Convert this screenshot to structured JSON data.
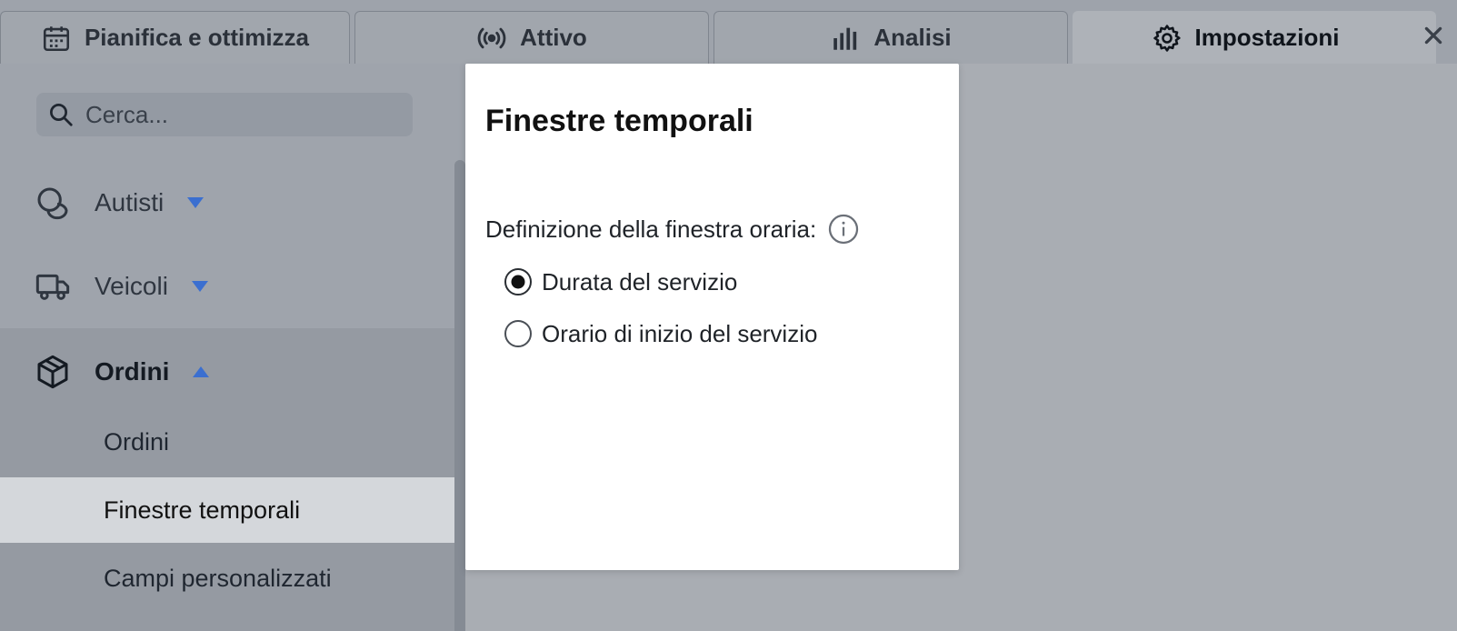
{
  "tabs": [
    {
      "label": "Pianifica e ottimizza",
      "icon": "calendar-icon"
    },
    {
      "label": "Attivo",
      "icon": "broadcast-icon"
    },
    {
      "label": "Analisi",
      "icon": "bar-chart-icon"
    },
    {
      "label": "Impostazioni",
      "icon": "gear-icon",
      "active": true
    }
  ],
  "close_icon": "close-icon",
  "sidebar": {
    "search": {
      "placeholder": "Cerca..."
    },
    "groups": [
      {
        "label": "Autisti",
        "icon": "driver-icon",
        "expanded": false
      },
      {
        "label": "Veicoli",
        "icon": "truck-icon",
        "expanded": false
      },
      {
        "label": "Ordini",
        "icon": "box-icon",
        "expanded": true
      }
    ],
    "order_items": [
      {
        "label": "Ordini"
      },
      {
        "label": "Finestre temporali",
        "active": true
      },
      {
        "label": "Campi personalizzati"
      }
    ]
  },
  "panel": {
    "title": "Finestre temporali",
    "field_label": "Definizione della finestra oraria:",
    "options": [
      {
        "label": "Durata del servizio",
        "selected": true
      },
      {
        "label": "Orario di inizio del servizio",
        "selected": false
      }
    ]
  },
  "colors": {
    "accent_caret": "#3b6fd0",
    "active_item_bg": "#d4d7db"
  }
}
